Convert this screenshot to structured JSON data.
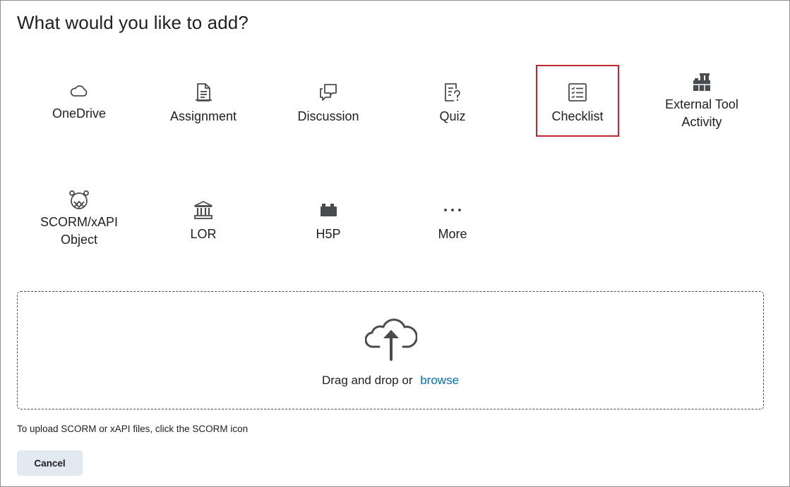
{
  "dialog": {
    "title": "What would you like to add?"
  },
  "tiles": [
    {
      "label": "OneDrive",
      "icon": "cloud-icon"
    },
    {
      "label": "Assignment",
      "icon": "assignment-icon"
    },
    {
      "label": "Discussion",
      "icon": "discussion-icon"
    },
    {
      "label": "Quiz",
      "icon": "quiz-icon"
    },
    {
      "label": "Checklist",
      "icon": "checklist-icon",
      "highlighted": true
    },
    {
      "label": "External Tool Activity",
      "label_line1": "External Tool",
      "label_line2": "Activity",
      "icon": "lego-blocks-icon"
    },
    {
      "label": "SCORM/xAPI Object",
      "label_line1": "SCORM/xAPI",
      "label_line2": "Object",
      "icon": "scorm-icon"
    },
    {
      "label": "LOR",
      "icon": "repository-icon"
    },
    {
      "label": "H5P",
      "icon": "h5p-block-icon"
    },
    {
      "label": "More",
      "icon": "more-dots-icon"
    }
  ],
  "upload": {
    "icon": "cloud-upload-icon",
    "drag_text": "Drag and drop or",
    "browse_link": "browse"
  },
  "hint_text": "To upload SCORM or xAPI files, click the SCORM icon",
  "cancel_label": "Cancel",
  "colors": {
    "highlight_border": "#c1272d",
    "link": "#006fbf",
    "cancel_bg": "#e3e9f1",
    "text": "#202122"
  }
}
